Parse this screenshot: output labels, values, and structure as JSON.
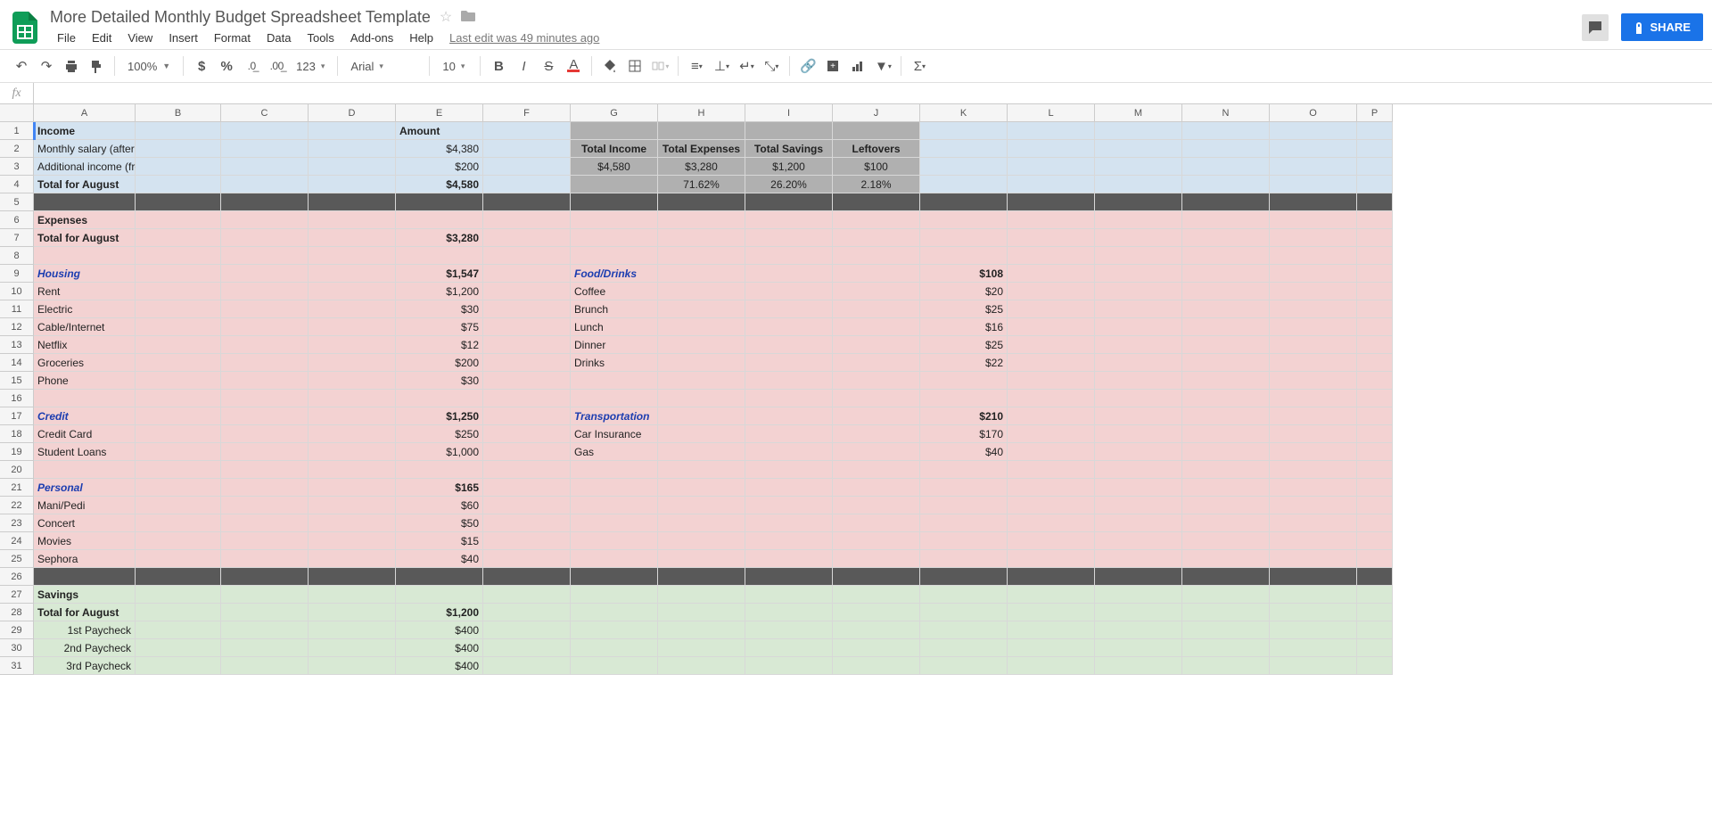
{
  "doc": {
    "title": "More Detailed Monthly Budget Spreadsheet Template",
    "last_edit": "Last edit was 49 minutes ago"
  },
  "menu": [
    "File",
    "Edit",
    "View",
    "Insert",
    "Format",
    "Data",
    "Tools",
    "Add-ons",
    "Help"
  ],
  "share": "SHARE",
  "toolbar": {
    "zoom": "100%",
    "number_format": "123",
    "font": "Arial",
    "font_size": "10"
  },
  "columns": [
    "A",
    "B",
    "C",
    "D",
    "E",
    "F",
    "G",
    "H",
    "I",
    "J",
    "K",
    "L",
    "M",
    "N",
    "O",
    "P"
  ],
  "rows": 31,
  "cells": {
    "r1": {
      "A": "Income",
      "E": "Amount"
    },
    "r2": {
      "A": "Monthly salary (after taxes, benefits and retirement contibutions)",
      "E": "$4,380",
      "G": "Total Income",
      "H": "Total Expenses",
      "I": "Total Savings",
      "J": "Leftovers"
    },
    "r3": {
      "A": "Additional income (freelance, babysitting, etc.)",
      "E": "$200",
      "G": "$4,580",
      "H": "$3,280",
      "I": "$1,200",
      "J": "$100"
    },
    "r4": {
      "A": "Total for August",
      "E": "$4,580",
      "H": "71.62%",
      "I": "26.20%",
      "J": "2.18%"
    },
    "r6": {
      "A": "Expenses"
    },
    "r7": {
      "A": "Total for August",
      "E": "$3,280"
    },
    "r9": {
      "A": "Housing",
      "E": "$1,547",
      "G": "Food/Drinks",
      "K": "$108"
    },
    "r10": {
      "A": "Rent",
      "E": "$1,200",
      "G": "Coffee",
      "K": "$20"
    },
    "r11": {
      "A": "Electric",
      "E": "$30",
      "G": "Brunch",
      "K": "$25"
    },
    "r12": {
      "A": "Cable/Internet",
      "E": "$75",
      "G": "Lunch",
      "K": "$16"
    },
    "r13": {
      "A": "Netflix",
      "E": "$12",
      "G": "Dinner",
      "K": "$25"
    },
    "r14": {
      "A": "Groceries",
      "E": "$200",
      "G": "Drinks",
      "K": "$22"
    },
    "r15": {
      "A": "Phone",
      "E": "$30"
    },
    "r17": {
      "A": "Credit",
      "E": "$1,250",
      "G": "Transportation",
      "K": "$210"
    },
    "r18": {
      "A": "Credit Card",
      "E": "$250",
      "G": "Car Insurance",
      "K": "$170"
    },
    "r19": {
      "A": "Student Loans",
      "E": "$1,000",
      "G": "Gas",
      "K": "$40"
    },
    "r21": {
      "A": "Personal",
      "E": "$165"
    },
    "r22": {
      "A": "Mani/Pedi",
      "E": "$60"
    },
    "r23": {
      "A": "Concert",
      "E": "$50"
    },
    "r24": {
      "A": "Movies",
      "E": "$15"
    },
    "r25": {
      "A": "Sephora",
      "E": "$40"
    },
    "r27": {
      "A": "Savings"
    },
    "r28": {
      "A": "Total for August",
      "E": "$1,200"
    },
    "r29": {
      "A": "1st Paycheck",
      "E": "$400"
    },
    "r30": {
      "A": "2nd Paycheck",
      "E": "$400"
    },
    "r31": {
      "A": "3rd Paycheck",
      "E": "$400"
    }
  },
  "row_styles": {
    "1": "blue",
    "2": "blue",
    "3": "blue",
    "4": "blue",
    "5": "dark",
    "6": "pink",
    "7": "pink",
    "8": "pink",
    "9": "pink",
    "10": "pink",
    "11": "pink",
    "12": "pink",
    "13": "pink",
    "14": "pink",
    "15": "pink",
    "16": "pink",
    "17": "pink",
    "18": "pink",
    "19": "pink",
    "20": "pink",
    "21": "pink",
    "22": "pink",
    "23": "pink",
    "24": "pink",
    "25": "pink",
    "26": "dark",
    "27": "green",
    "28": "green",
    "29": "green",
    "30": "green",
    "31": "green"
  },
  "summary_gray_rows": [
    1,
    2,
    3,
    4
  ],
  "bold_cells": [
    "1A",
    "1E",
    "2G",
    "2H",
    "2I",
    "2J",
    "4A",
    "4E",
    "6A",
    "7A",
    "7E",
    "9A",
    "9E",
    "9G",
    "9K",
    "17A",
    "17E",
    "17G",
    "17K",
    "21A",
    "21E",
    "27A",
    "28A",
    "28E"
  ],
  "cat_cells": [
    "9A",
    "9G",
    "17A",
    "17G",
    "21A"
  ],
  "center_cells": [
    "2G",
    "2H",
    "2I",
    "2J",
    "3G",
    "3H",
    "3I",
    "3J",
    "4H",
    "4I",
    "4J"
  ]
}
